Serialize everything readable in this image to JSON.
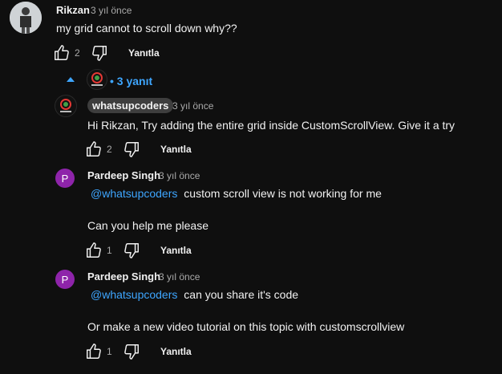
{
  "comment": {
    "author": "Rikzan",
    "time": "3 yıl önce",
    "text": "my grid cannot to scroll down why??",
    "likes": "2",
    "reply_label": "Yanıtla"
  },
  "replies_toggle": {
    "label": "3 yanıt",
    "dot": "•"
  },
  "replies": [
    {
      "author": "whatsupcoders",
      "time": "3 yıl önce",
      "text": "Hi Rikzan, Try adding the entire grid inside CustomScrollView. Give it a try",
      "likes": "2",
      "reply_label": "Yanıtla"
    },
    {
      "author": "Pardeep Singh",
      "avatar_letter": "P",
      "time": "3 yıl önce",
      "mention": "@whatsupcoders",
      "text": "custom scroll view is not working for me",
      "text2": "Can you help me please",
      "likes": "1",
      "reply_label": "Yanıtla"
    },
    {
      "author": "Pardeep Singh",
      "avatar_letter": "P",
      "time": "3 yıl önce",
      "mention": "@whatsupcoders",
      "text": "can you share it's code",
      "text2": "Or make a new video tutorial on this topic with customscrollview",
      "likes": "1",
      "reply_label": "Yanıtla"
    }
  ],
  "colors": {
    "background": "#0f0f0f",
    "link": "#3ea6ff",
    "avatar_p": "#8e24aa"
  }
}
